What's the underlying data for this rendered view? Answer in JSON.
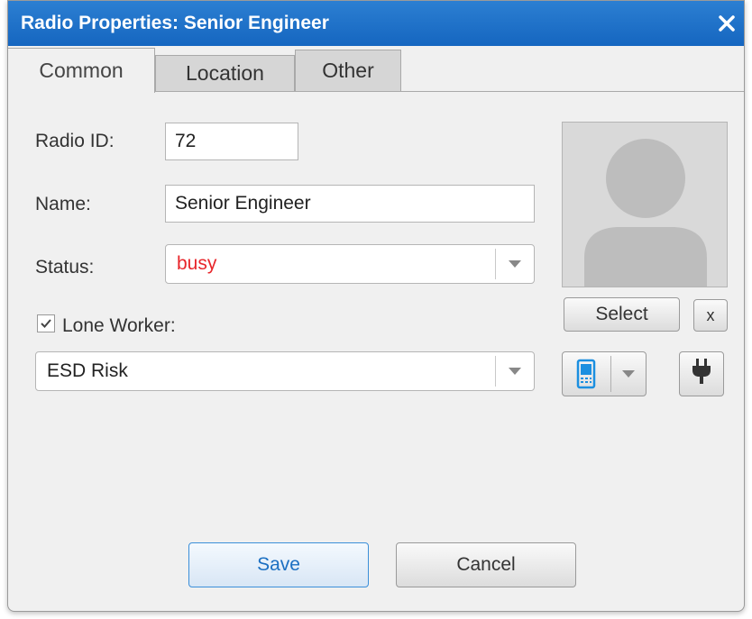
{
  "window": {
    "title": "Radio Properties: Senior Engineer"
  },
  "tabs": [
    {
      "label": "Common",
      "active": true
    },
    {
      "label": "Location",
      "active": false
    },
    {
      "label": "Other",
      "active": false
    }
  ],
  "form": {
    "radio_id_label": "Radio ID:",
    "radio_id_value": "72",
    "name_label": "Name:",
    "name_value": "Senior Engineer",
    "status_label": "Status:",
    "status_value": "busy",
    "status_color": "#e8262b",
    "lone_worker_label": "Lone Worker:",
    "lone_worker_checked": true,
    "lone_worker_value": "ESD Risk"
  },
  "photo": {
    "select_label": "Select",
    "clear_label": "x"
  },
  "icons": {
    "device": "mobile-radio-icon",
    "power": "plug-icon",
    "close": "close-icon"
  },
  "footer": {
    "save_label": "Save",
    "cancel_label": "Cancel"
  },
  "colors": {
    "accent": "#1b6fc2",
    "title_bar": "#1a6cc8"
  }
}
